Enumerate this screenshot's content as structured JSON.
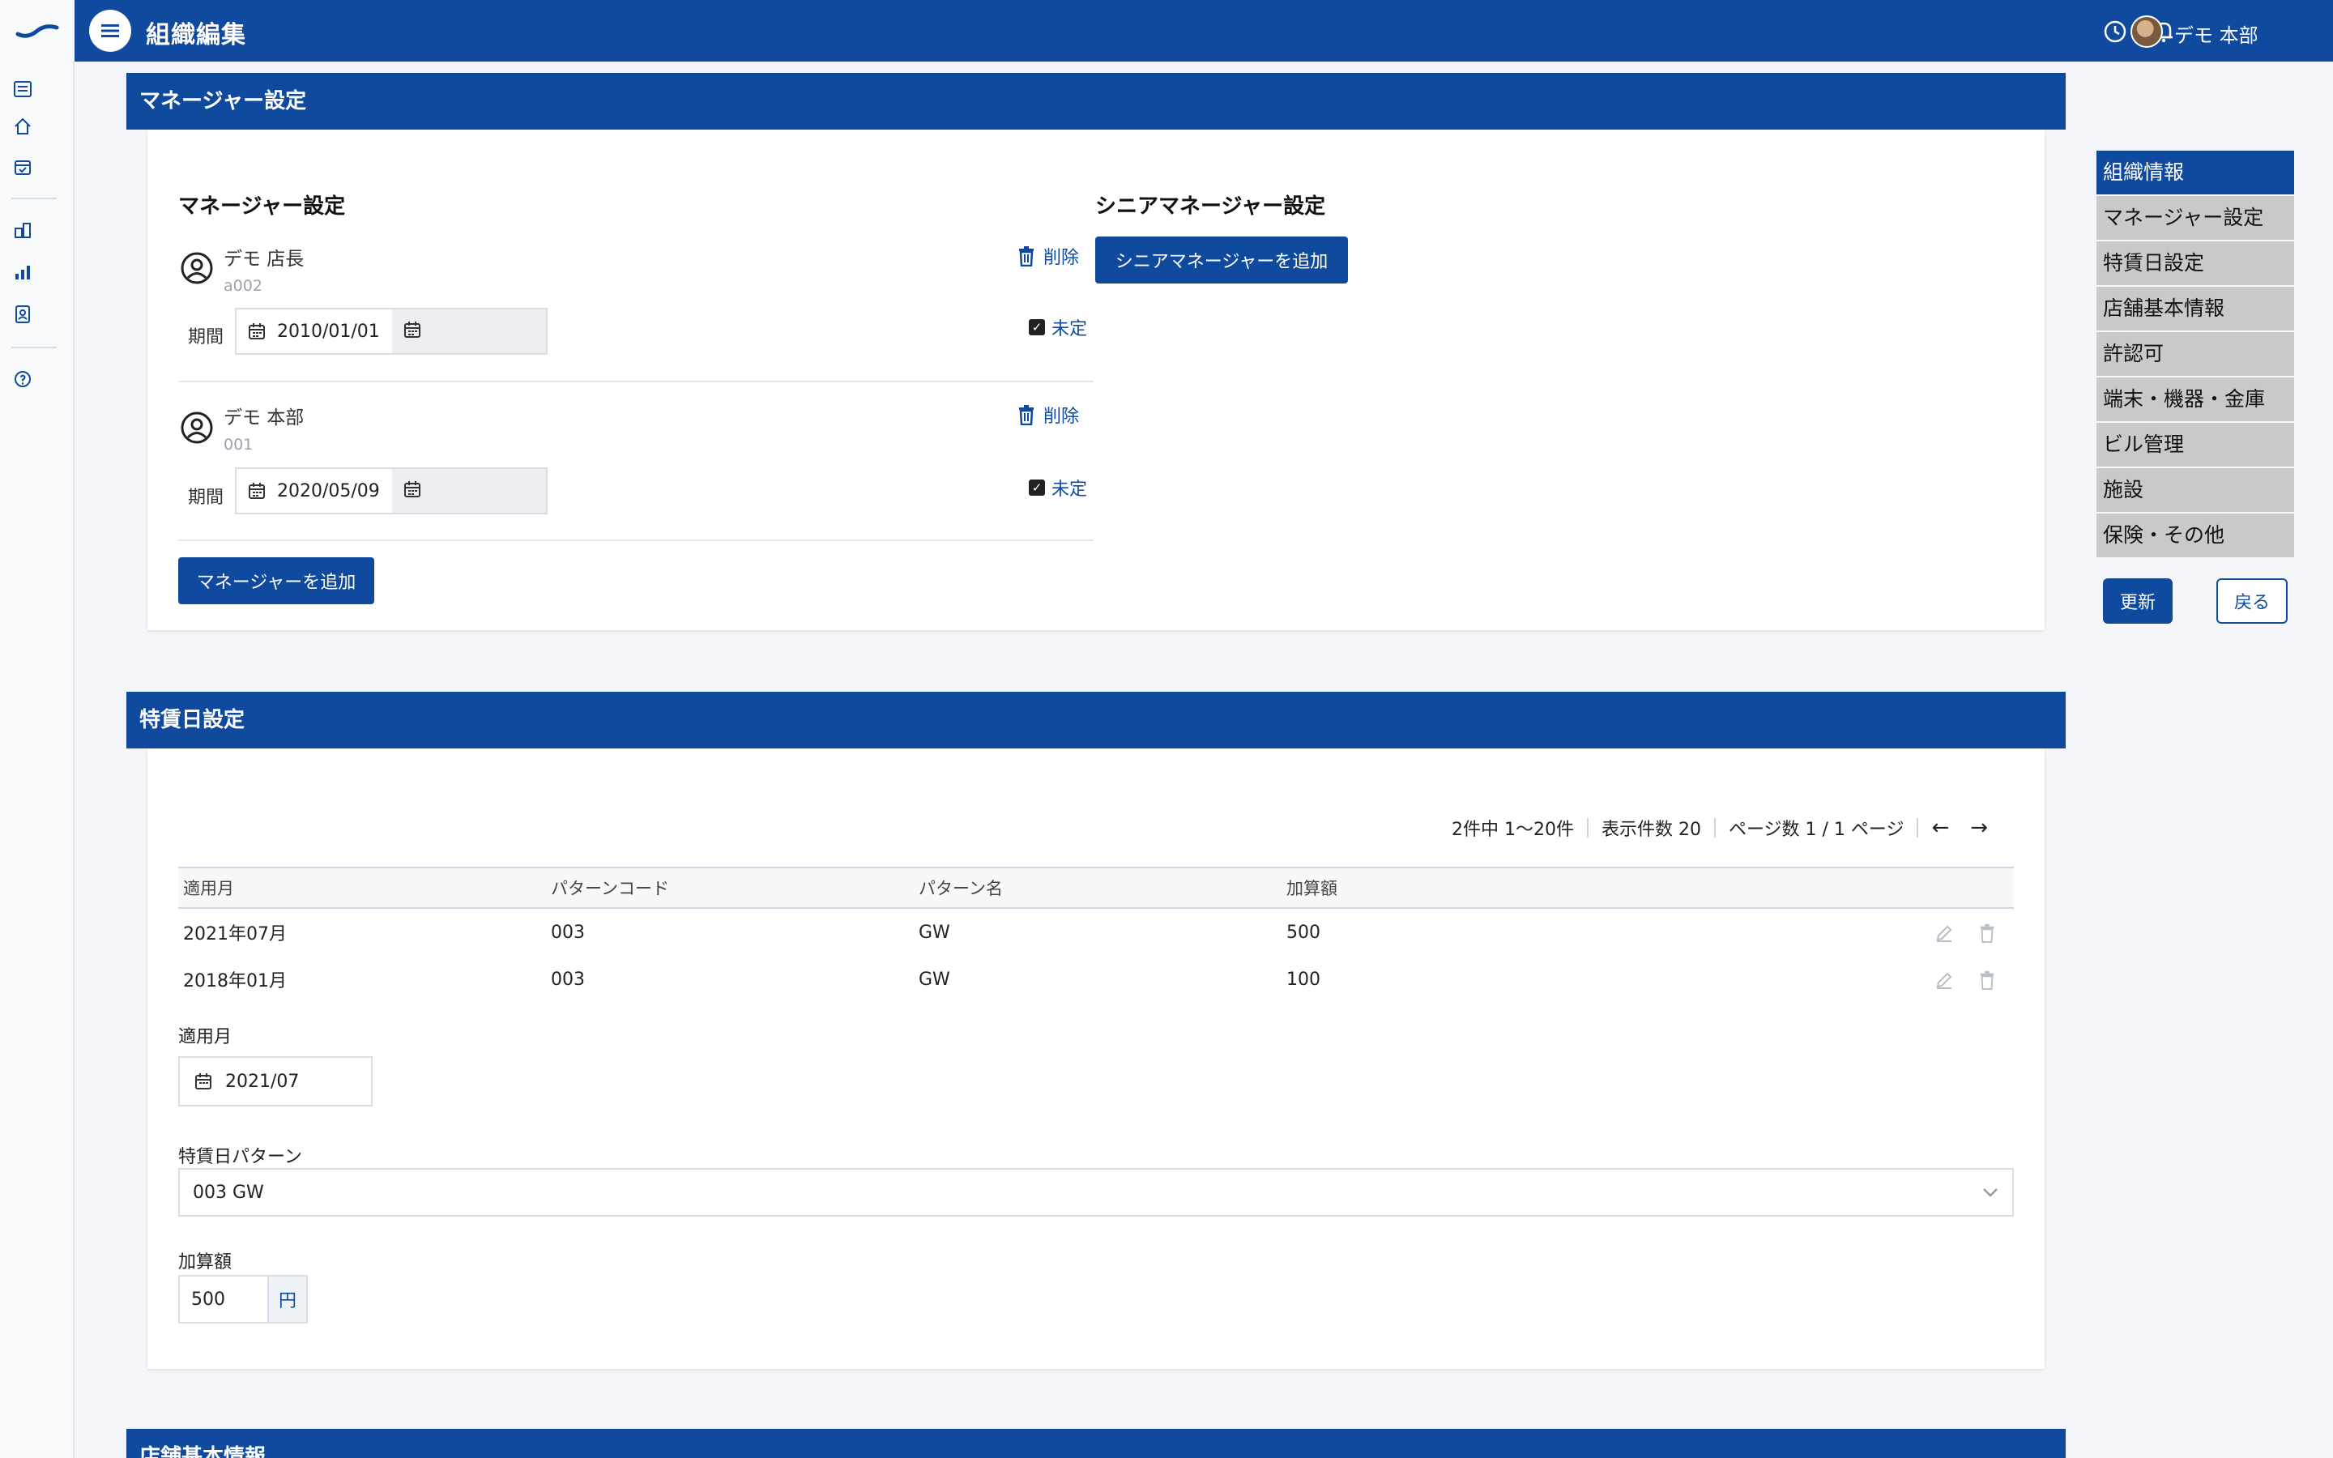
{
  "app": {
    "page_title": "組織編集",
    "user_name": "デモ 本部"
  },
  "rail_icons": [
    "list-icon",
    "home-icon",
    "calendar-check-icon",
    "building-chart-icon",
    "bar-chart-icon",
    "id-badge-icon",
    "help-icon"
  ],
  "manager_section": {
    "header": "マネージャー設定",
    "managers_title": "マネージャー設定",
    "senior_title": "シニアマネージャー設定",
    "add_senior_label": "シニアマネージャーを追加",
    "add_manager_label": "マネージャーを追加",
    "period_label": "期間",
    "delete_label": "削除",
    "pending_label": "未定",
    "managers": [
      {
        "name": "デモ 店長",
        "code": "a002",
        "start_date": "2010/01/01"
      },
      {
        "name": "デモ 本部",
        "code": "001",
        "start_date": "2020/05/09"
      }
    ]
  },
  "right_nav": {
    "items": [
      "組織情報",
      "マネージャー設定",
      "特賃日設定",
      "店舗基本情報",
      "許認可",
      "端末・機器・金庫",
      "ビル管理",
      "施設",
      "保険・その他"
    ],
    "active_index": 0,
    "update_label": "更新",
    "back_label": "戻る"
  },
  "special_section": {
    "header": "特賃日設定",
    "pager": {
      "summary": "2件中 1〜20件",
      "per_page": "表示件数 20",
      "page_info": "ページ数 1 / 1 ページ",
      "prev": "←",
      "next": "→"
    },
    "columns": [
      "適用月",
      "パターンコード",
      "パターン名",
      "加算額"
    ],
    "rows": [
      [
        "2021年07月",
        "003",
        "GW",
        "500"
      ],
      [
        "2018年01月",
        "003",
        "GW",
        "100"
      ]
    ],
    "form": {
      "month_label": "適用月",
      "month_value": "2021/07",
      "pattern_label": "特賃日パターン",
      "pattern_value": "003 GW",
      "amount_label": "加算額",
      "amount_value": "500",
      "amount_unit": "円"
    }
  },
  "store_section": {
    "header": "店舗基本情報"
  },
  "colors": {
    "primary": "#0f4a9e",
    "nav_inactive": "#c9c9c9"
  }
}
